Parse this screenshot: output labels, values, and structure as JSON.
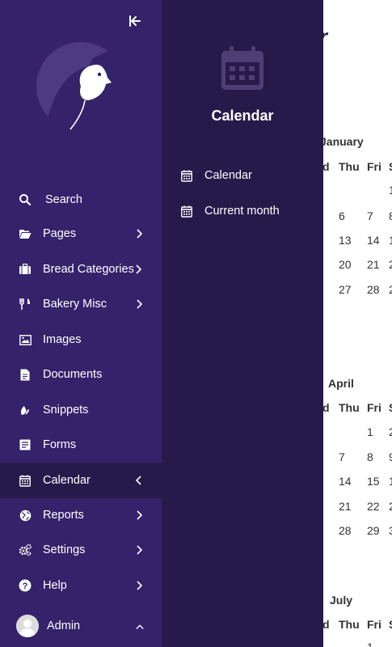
{
  "main": {
    "title_fragment": "r",
    "months": [
      {
        "name": "January",
        "headers": [
          "d",
          "Thu",
          "Fri",
          "S"
        ],
        "rows": [
          [
            "",
            "",
            "",
            "1"
          ],
          [
            "",
            "6",
            "7",
            "8"
          ],
          [
            "",
            "13",
            "14",
            "1"
          ],
          [
            "",
            "20",
            "21",
            "2"
          ],
          [
            "",
            "27",
            "28",
            "2"
          ]
        ]
      },
      {
        "name": "April",
        "headers": [
          "d",
          "Thu",
          "Fri",
          "S"
        ],
        "rows": [
          [
            "",
            "",
            "1",
            "2"
          ],
          [
            "",
            "7",
            "8",
            "9"
          ],
          [
            "",
            "14",
            "15",
            "1"
          ],
          [
            "",
            "21",
            "22",
            "2"
          ],
          [
            "",
            "28",
            "29",
            "3"
          ]
        ]
      },
      {
        "name": "July",
        "headers": [
          "d",
          "Thu",
          "Fri",
          "S"
        ],
        "rows": [
          [
            "",
            "",
            "1",
            ""
          ]
        ]
      }
    ]
  },
  "sidebar": {
    "items": [
      {
        "label": "Search",
        "icon": "search-icon"
      },
      {
        "label": "Pages",
        "icon": "folder-open-icon"
      },
      {
        "label": "Bread Categories",
        "icon": "suitcase-icon"
      },
      {
        "label": "Bakery Misc",
        "icon": "utensils-icon"
      },
      {
        "label": "Images",
        "icon": "image-icon"
      },
      {
        "label": "Documents",
        "icon": "document-icon"
      },
      {
        "label": "Snippets",
        "icon": "snippet-icon"
      },
      {
        "label": "Forms",
        "icon": "form-icon"
      },
      {
        "label": "Calendar",
        "icon": "calendar-icon"
      },
      {
        "label": "Reports",
        "icon": "globe-icon"
      },
      {
        "label": "Settings",
        "icon": "cogs-icon"
      },
      {
        "label": "Help",
        "icon": "help-icon"
      }
    ],
    "account": {
      "label": "Admin"
    }
  },
  "submenu": {
    "title": "Calendar",
    "items": [
      {
        "label": "Calendar",
        "icon": "calendar-icon"
      },
      {
        "label": "Current month",
        "icon": "calendar-icon"
      }
    ]
  },
  "colors": {
    "sidebar_bg": "#34226a",
    "submenu_bg": "#261a4b",
    "title_color": "#261a4b"
  }
}
